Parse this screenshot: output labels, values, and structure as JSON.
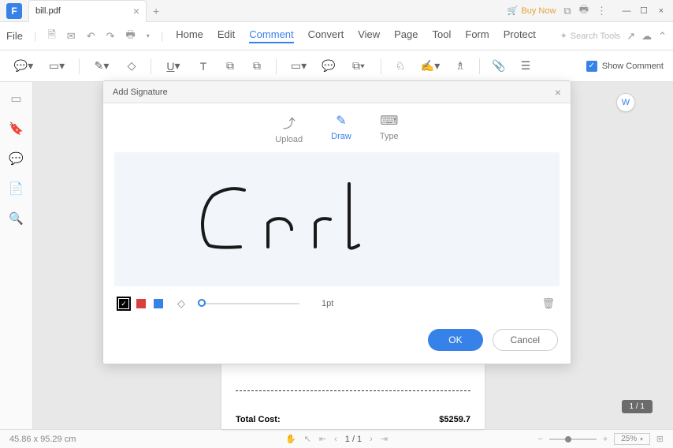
{
  "titlebar": {
    "filename": "bill.pdf",
    "buy_now": "Buy Now"
  },
  "menubar": {
    "file": "File",
    "items": [
      "Home",
      "Edit",
      "Comment",
      "Convert",
      "View",
      "Page",
      "Tool",
      "Form",
      "Protect"
    ],
    "active_index": 2,
    "search_placeholder": "Search Tools"
  },
  "toolbar": {
    "show_comment": "Show Comment"
  },
  "modal": {
    "title": "Add Signature",
    "tabs": [
      "Upload",
      "Draw",
      "Type"
    ],
    "active_tab_index": 1,
    "colors": [
      "#000000",
      "#d93f3f",
      "#3782e8"
    ],
    "active_color_index": 0,
    "stroke_label": "1pt",
    "ok": "OK",
    "cancel": "Cancel",
    "signature_text": "Carl"
  },
  "page": {
    "total_cost_label": "Total Cost:",
    "total_cost_value": "$5259.7"
  },
  "statusbar": {
    "cursor_pos": "45.86 x 95.29 cm",
    "page_current": "1",
    "page_total": "/ 1",
    "zoom": "25%"
  },
  "page_badge": "1 / 1"
}
